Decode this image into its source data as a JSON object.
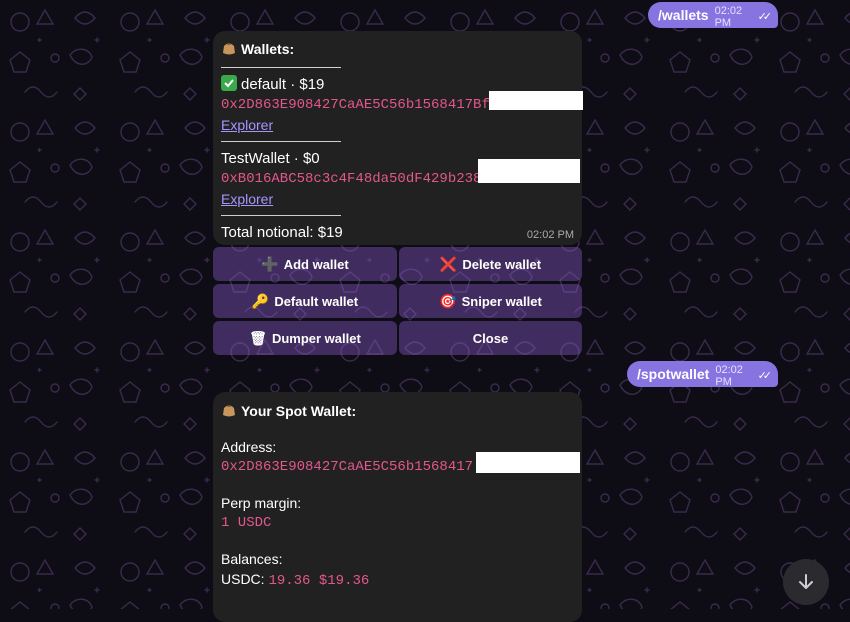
{
  "outgoing": [
    {
      "text": "/wallets",
      "time": "02:02 PM"
    },
    {
      "text": "/spotwallet",
      "time": "02:02 PM"
    }
  ],
  "wallets_msg": {
    "title": "Wallets:",
    "title_icon": "bag-icon",
    "wallets": [
      {
        "label": "default · $19",
        "status_icon": "green-check-icon",
        "address": "0x2D863E908427CaAE5C56b1568417Bf",
        "link": "Explorer"
      },
      {
        "label": "TestWallet · $0",
        "address": "0xB016ABC58c3c4F48da50dF429b238",
        "link": "Explorer"
      }
    ],
    "total": "Total notional: $19",
    "time": "02:02 PM"
  },
  "keyboard": [
    {
      "label": "Add wallet",
      "icon": "plus-icon",
      "glyph": "➕"
    },
    {
      "label": "Delete wallet",
      "icon": "red-x-icon",
      "glyph": "❌"
    },
    {
      "label": "Default wallet",
      "icon": "key-icon",
      "glyph": "🔑"
    },
    {
      "label": "Sniper wallet",
      "icon": "target-icon",
      "glyph": "🎯"
    },
    {
      "label": "Dumper wallet",
      "icon": "trash-icon",
      "glyph": "🗑"
    },
    {
      "label": "Close",
      "icon": "",
      "glyph": ""
    }
  ],
  "spot_msg": {
    "title": "Your Spot Wallet:",
    "title_icon": "bag-icon",
    "address_label": "Address:",
    "address": "0x2D863E908427CaAE5C56b1568417",
    "perp_label": "Perp margin:",
    "perp_value": "1 USDC",
    "balances_label": "Balances:",
    "usdc_label": "USDC:",
    "usdc_value": "19.36 $19.36"
  },
  "colors": {
    "accent": "#8774e1",
    "mono": "#e3578c",
    "link": "#a595ff",
    "bubble": "#212121"
  }
}
